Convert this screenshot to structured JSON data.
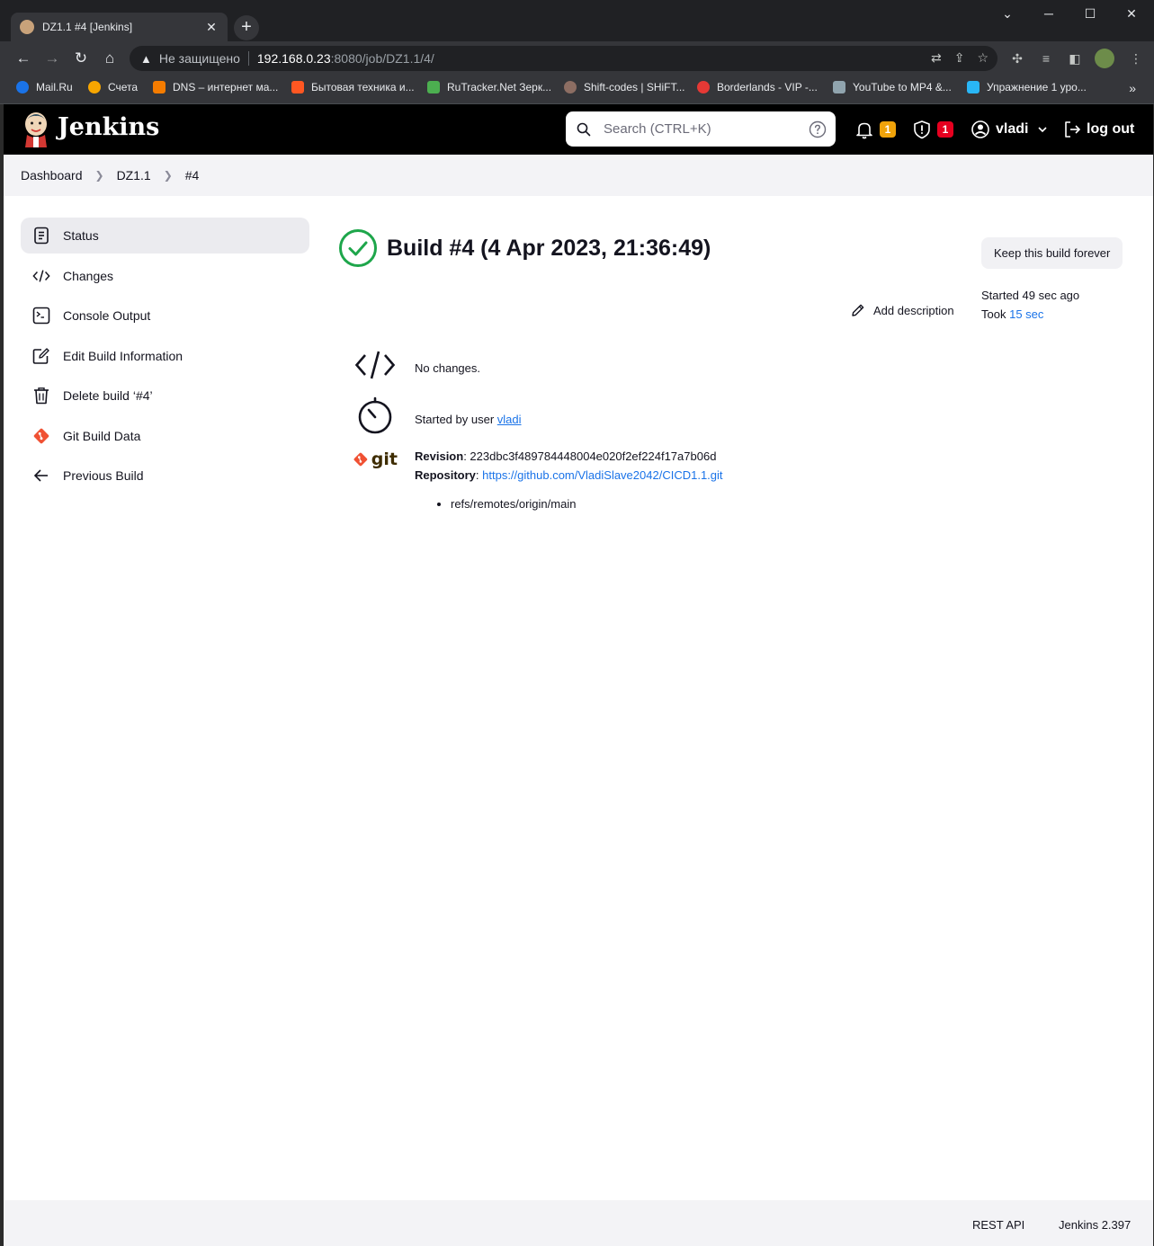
{
  "browser": {
    "tab_title": "DZ1.1 #4 [Jenkins]",
    "tab_close": "✕",
    "new_tab": "+",
    "address": {
      "security_label": "Не защищено",
      "host": "192.168.0.23",
      "path": ":8080/job/DZ1.1/4/"
    },
    "bookmarks": [
      {
        "label": "Mail.Ru",
        "color": "#1a73e8"
      },
      {
        "label": "Счета",
        "color": "#f7a600"
      },
      {
        "label": "DNS – интернет ма...",
        "color": "#f57c00"
      },
      {
        "label": "Бытовая техника и...",
        "color": "#ff5722"
      },
      {
        "label": "RuTracker.Net Зерк...",
        "color": "#4caf50"
      },
      {
        "label": "Shift-codes | SHiFT...",
        "color": "#8d6e63"
      },
      {
        "label": "Borderlands - VIP -...",
        "color": "#e53935"
      },
      {
        "label": "YouTube to MP4 &...",
        "color": "#90a4ae"
      },
      {
        "label": "Упражнение 1 уро...",
        "color": "#29b6f6"
      }
    ],
    "bookmarks_more": "»"
  },
  "header": {
    "brand": "Jenkins",
    "search_placeholder": "Search (CTRL+K)",
    "notifications_count": "1",
    "security_count": "1",
    "user": "vladi",
    "logout": "log out",
    "colors": {
      "notification_badge": "#f0a30a",
      "security_badge": "#e6001f"
    }
  },
  "breadcrumbs": [
    "Dashboard",
    "DZ1.1",
    "#4"
  ],
  "sidebar": [
    {
      "label": "Status",
      "icon": "document-icon",
      "active": true
    },
    {
      "label": "Changes",
      "icon": "code-icon"
    },
    {
      "label": "Console Output",
      "icon": "terminal-icon"
    },
    {
      "label": "Edit Build Information",
      "icon": "edit-icon"
    },
    {
      "label": "Delete build ‘#4’",
      "icon": "trash-icon"
    },
    {
      "label": "Git Build Data",
      "icon": "git-icon"
    },
    {
      "label": "Previous Build",
      "icon": "arrow-left-icon"
    }
  ],
  "build": {
    "title": "Build #4 (4 Apr 2023, 21:36:49)",
    "status_color": "#1ea64b",
    "keep_forever": "Keep this build forever",
    "started_text": "Started 49 sec ago",
    "took_prefix": "Took",
    "took_value": "15 sec",
    "add_description": "Add description",
    "changes_text": "No changes.",
    "started_by_prefix": "Started by user",
    "started_by_user": "vladi",
    "git_logo_text": "git",
    "revision_label": "Revision",
    "revision_value": "223dbc3f489784448004e020f2ef224f17a7b06d",
    "repository_label": "Repository",
    "repository_url": "https://github.com/VladiSlave2042/CICD1.1.git",
    "refs": [
      "refs/remotes/origin/main"
    ]
  },
  "footer": {
    "rest_api": "REST API",
    "version": "Jenkins 2.397"
  }
}
